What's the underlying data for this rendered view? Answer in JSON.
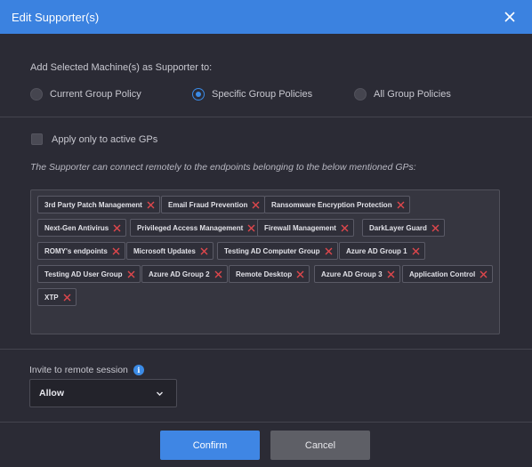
{
  "dialog": {
    "title": "Edit Supporter(s)"
  },
  "add_section": {
    "label": "Add Selected Machine(s) as Supporter to:",
    "options": [
      {
        "label": "Current Group Policy",
        "checked": false
      },
      {
        "label": "Specific Group Policies",
        "checked": true
      },
      {
        "label": "All Group Policies",
        "checked": false
      }
    ]
  },
  "active_only": {
    "label": "Apply only to active GPs",
    "checked": false
  },
  "note": "The Supporter can connect remotely to the endpoints belonging to the below mentioned GPs:",
  "tags": [
    "3rd Party Patch Management",
    "Email Fraud Prevention",
    "Ransomware Encryption Protection",
    "Next-Gen Antivirus",
    "Privileged Access Management",
    "Firewall Management",
    "DarkLayer Guard",
    "ROMY's endpoints",
    "Microsoft Updates",
    "Testing AD Computer Group",
    "Azure AD Group 1",
    "Testing AD User Group",
    "Azure AD Group 2",
    "Remote Desktop",
    "Azure AD Group 3",
    "Application Control",
    "XTP"
  ],
  "invite": {
    "label": "Invite to remote session",
    "info_icon": "i",
    "selected": "Allow"
  },
  "buttons": {
    "confirm": "Confirm",
    "cancel": "Cancel"
  },
  "colors": {
    "header": "#3b82e0",
    "background": "#2b2b35",
    "remove_x": "#e0474c",
    "confirm": "#3f86e4",
    "cancel": "#5e5f66"
  }
}
